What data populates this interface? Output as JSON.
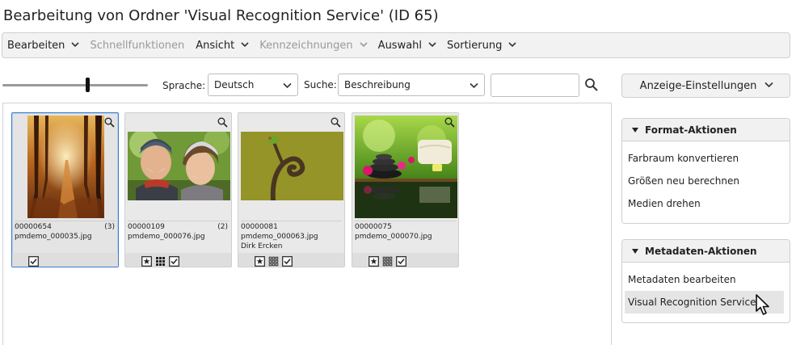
{
  "title": "Bearbeitung von Ordner 'Visual Recognition Service' (ID 65)",
  "menu": [
    {
      "label": "Bearbeiten",
      "enabled": true
    },
    {
      "label": "Schnellfunktionen",
      "enabled": false
    },
    {
      "label": "Ansicht",
      "enabled": true
    },
    {
      "label": "Kennzeichnungen",
      "enabled": false
    },
    {
      "label": "Auswahl",
      "enabled": true
    },
    {
      "label": "Sortierung",
      "enabled": true
    }
  ],
  "toolbar": {
    "language_label": "Sprache:",
    "language_value": "Deutsch",
    "search_label": "Suche:",
    "search_field_value": "Beschreibung",
    "search_input_value": "",
    "display_settings_label": "Anzeige-Einstellungen"
  },
  "cards": [
    {
      "id": "00000654",
      "count": "(3)",
      "filename": "pmdemo_000035.jpg",
      "author": "",
      "selected": true,
      "image": "forest-path"
    },
    {
      "id": "00000109",
      "count": "(2)",
      "filename": "pmdemo_000076.jpg",
      "author": "",
      "selected": false,
      "image": "couple-winter"
    },
    {
      "id": "00000081",
      "count": "",
      "filename": "pmdemo_000063.jpg",
      "author": "Dirk Ercken",
      "selected": false,
      "image": "frog-twig"
    },
    {
      "id": "00000075",
      "count": "",
      "filename": "pmdemo_000070.jpg",
      "author": "",
      "selected": false,
      "image": "spa-stones"
    }
  ],
  "format_panel": {
    "title": "Format-Aktionen",
    "items": [
      "Farbraum konvertieren",
      "Größen neu berechnen",
      "Medien drehen"
    ]
  },
  "metadata_panel": {
    "title": "Metadaten-Aktionen",
    "items": [
      "Metadaten bearbeiten",
      "Visual Recognition Service"
    ],
    "hovered_index": 1
  },
  "colors": {
    "selected_border": "#3b7bc8",
    "menubar_bg": "#f2f2f2",
    "panel_head_bg": "#f1f1f1"
  }
}
